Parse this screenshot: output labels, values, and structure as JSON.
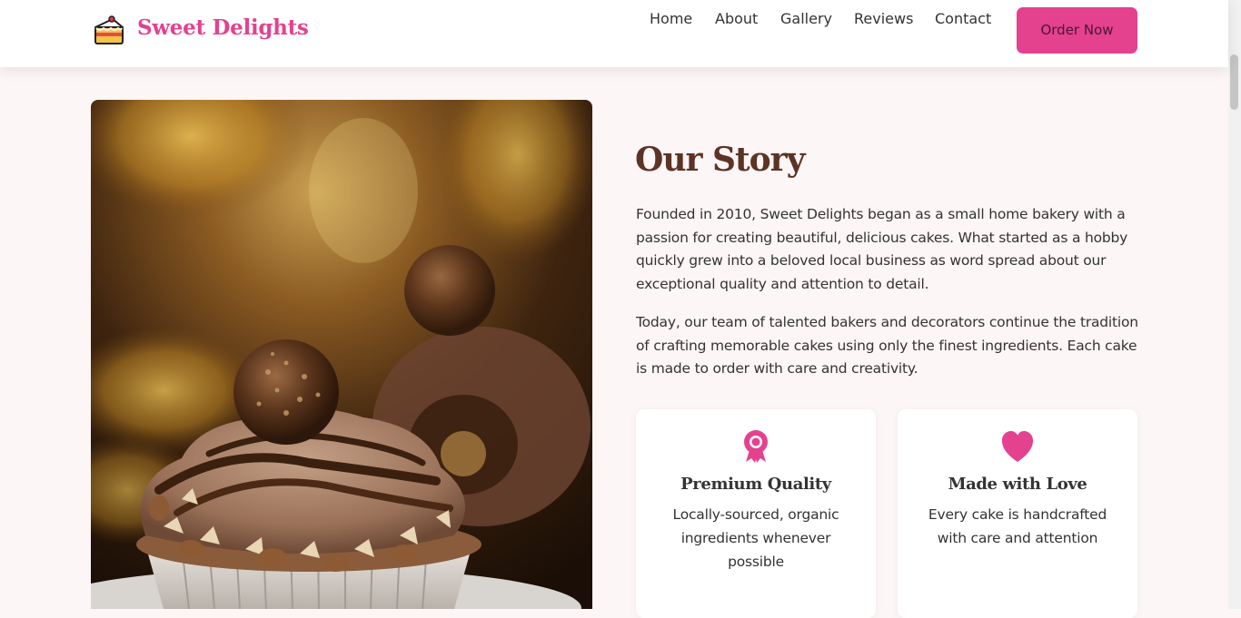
{
  "header": {
    "brand": "Sweet Delights",
    "logo_icon": "cake-slice-icon",
    "nav": [
      "Home",
      "About",
      "Gallery",
      "Reviews",
      "Contact"
    ],
    "cta": "Order Now"
  },
  "about": {
    "image_alt": "Chocolate hazelnut cupcake topped with a praline truffle",
    "title": "Our Story",
    "paragraphs": [
      "Founded in 2010, Sweet Delights began as a small home bakery with a passion for creating beautiful, delicious cakes. What started as a hobby quickly grew into a beloved local business as word spread about our exceptional quality and attention to detail.",
      "Today, our team of talented bakers and decorators continue the tradition of crafting memorable cakes using only the finest ingredients. Each cake is made to order with care and creativity."
    ],
    "features": [
      {
        "icon": "award-ribbon-icon",
        "title": "Premium Quality",
        "text": "Locally-sourced, organic ingredients whenever possible"
      },
      {
        "icon": "heart-icon",
        "title": "Made with Love",
        "text": "Every cake is handcrafted with care and attention"
      }
    ]
  },
  "colors": {
    "accent": "#e4418f",
    "heading_brown": "#5c3324",
    "page_background": "#fdf6f6"
  }
}
